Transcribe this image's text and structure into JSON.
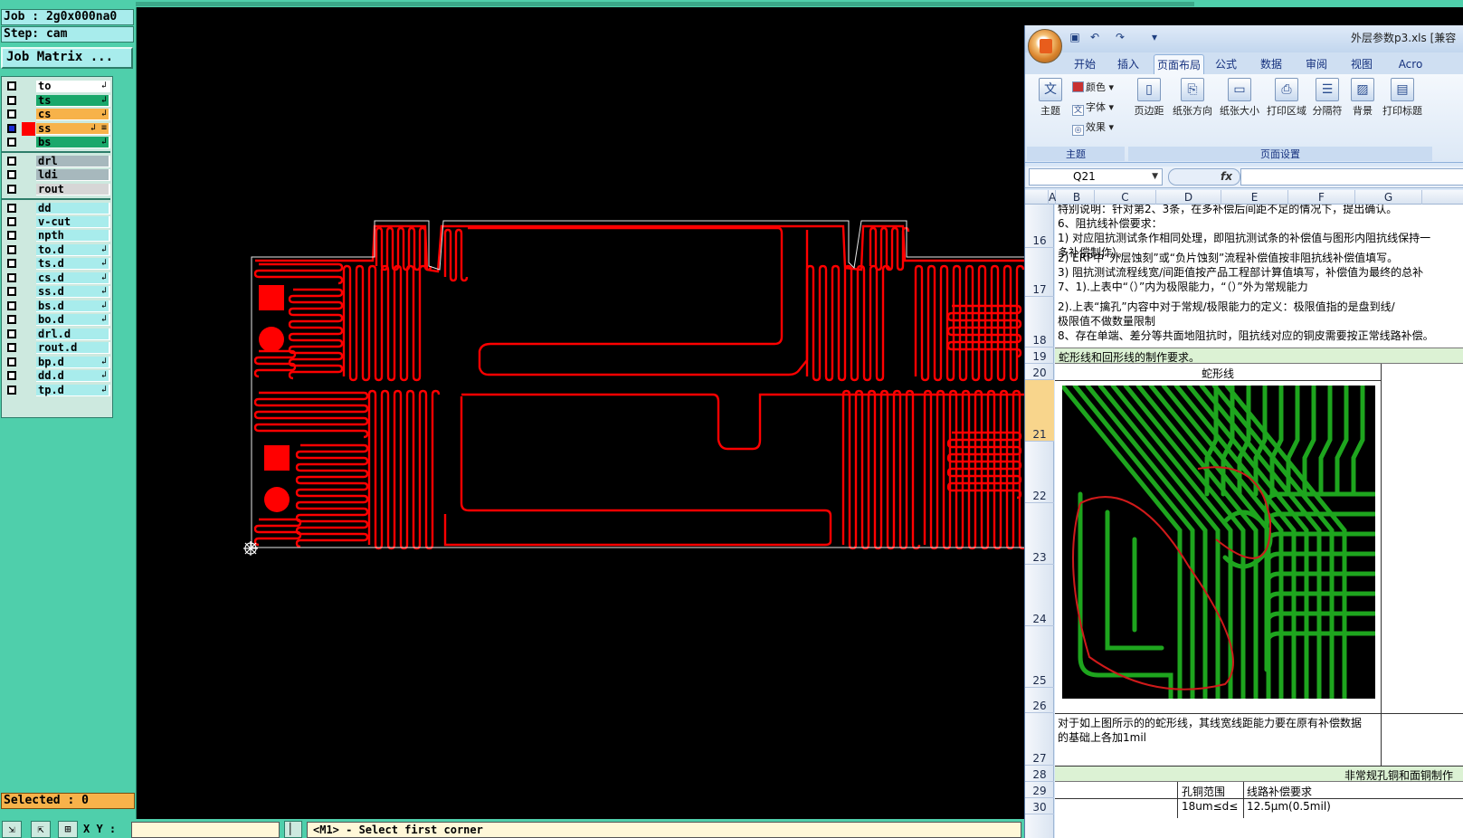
{
  "cam": {
    "job": "Job : 2g0x000na0",
    "step": "Step: cam",
    "job_matrix": "Job Matrix ...",
    "selected": "Selected : 0",
    "xy_label": "X Y :",
    "status": "<M1> - Select first corner",
    "layers": [
      {
        "name": "to",
        "color": "#ffffff",
        "checked": false,
        "flag": "↲"
      },
      {
        "name": "ts",
        "color": "#1aa86b",
        "checked": false,
        "flag": "↲"
      },
      {
        "name": "cs",
        "color": "#f7b24a",
        "checked": false,
        "flag": "↲"
      },
      {
        "name": "ss",
        "color": "#f7b24a",
        "checked": true,
        "flag": "↲ ≡"
      },
      {
        "name": "bs",
        "color": "#1aa86b",
        "checked": false,
        "flag": "↲"
      },
      {
        "name": "drl",
        "color": "#a7b8bd",
        "checked": false,
        "flag": ""
      },
      {
        "name": "ldi",
        "color": "#a7b8bd",
        "checked": false,
        "flag": ""
      },
      {
        "name": "rout",
        "color": "#d6d6d6",
        "checked": false,
        "flag": ""
      },
      {
        "name": "dd",
        "color": "#a8ecec",
        "checked": false,
        "flag": ""
      },
      {
        "name": "v-cut",
        "color": "#a8ecec",
        "checked": false,
        "flag": ""
      },
      {
        "name": "npth",
        "color": "#a8ecec",
        "checked": false,
        "flag": ""
      },
      {
        "name": "to.d",
        "color": "#a8ecec",
        "checked": false,
        "flag": "↲"
      },
      {
        "name": "ts.d",
        "color": "#a8ecec",
        "checked": false,
        "flag": "↲"
      },
      {
        "name": "cs.d",
        "color": "#a8ecec",
        "checked": false,
        "flag": "↲"
      },
      {
        "name": "ss.d",
        "color": "#a8ecec",
        "checked": false,
        "flag": "↲"
      },
      {
        "name": "bs.d",
        "color": "#a8ecec",
        "checked": false,
        "flag": "↲"
      },
      {
        "name": "bo.d",
        "color": "#a8ecec",
        "checked": false,
        "flag": "↲"
      },
      {
        "name": "drl.d",
        "color": "#a8ecec",
        "checked": false,
        "flag": ""
      },
      {
        "name": "rout.d",
        "color": "#a8ecec",
        "checked": false,
        "flag": ""
      },
      {
        "name": "bp.d",
        "color": "#a8ecec",
        "checked": false,
        "flag": "↲"
      },
      {
        "name": "dd.d",
        "color": "#a8ecec",
        "checked": false,
        "flag": "↲"
      },
      {
        "name": "tp.d",
        "color": "#a8ecec",
        "checked": false,
        "flag": "↲"
      }
    ],
    "trace_color": "#ff0000"
  },
  "excel": {
    "filename": "外层参数p3.xls  [兼容",
    "tabs": [
      "开始",
      "插入",
      "页面布局",
      "公式",
      "数据",
      "审阅",
      "视图",
      "Acro"
    ],
    "active_tab": "页面布局",
    "ribbon": {
      "theme_label": "主题",
      "colors_label": "颜色",
      "fonts_label": "字体",
      "effects_label": "效果",
      "margins_label": "页边距",
      "orientation_label": "纸张方向",
      "size_label": "纸张大小",
      "print_area_label": "打印区域",
      "breaks_label": "分隔符",
      "background_label": "背景",
      "print_titles_label": "打印标题",
      "group_theme": "主题",
      "group_page_setup": "页面设置"
    },
    "name_box": "Q21",
    "fx": "fx",
    "columns": [
      "A",
      "B",
      "C",
      "D",
      "E",
      "F",
      "G"
    ],
    "rows": [
      {
        "num": "16",
        "lines": [
          "特别说明：针对第2、3条，在多补偿后间距不足的情况下，提出确认。",
          "6、阻抗线补偿要求：",
          "1) 对应阻抗测试条作相同处理，即阻抗测试条的补偿值与图形内阻抗线保持一",
          "多补偿制作）。"
        ]
      },
      {
        "num": "17",
        "lines": [
          "2) ERP中“外层蚀刻”或“负片蚀刻”流程补偿值按非阻抗线补偿值填写。",
          "3) 阻抗测试流程线宽/间距值按产品工程部计算值填写，补偿值为最终的总补",
          "7、1).上表中“（）”内为极限能力，“（）”外为常规能力"
        ]
      },
      {
        "num": "18",
        "lines": [
          "    2).上表“擒孔”内容中对于常规/极限能力的定义：极限值指的是盘到线/",
          "极限值不做数量限制",
          "8、存在单端、差分等共面地阻抗时，阻抗线对应的铜皮需要按正常线路补偿。"
        ]
      },
      {
        "num": "19",
        "text": "蛇形线和回形线的制作要求。"
      },
      {
        "num": "20",
        "text": "蛇形线"
      },
      {
        "num": "21",
        "text": ""
      },
      {
        "num": "22",
        "text": ""
      },
      {
        "num": "23",
        "text": ""
      },
      {
        "num": "24",
        "text": ""
      },
      {
        "num": "25",
        "text": ""
      },
      {
        "num": "26",
        "text": ""
      },
      {
        "num": "27",
        "lines": [
          "对于如上图所示的的蛇形线，其线宽线距能力要在原有补偿数据",
          "的基础上各加1mil"
        ]
      },
      {
        "num": "28",
        "text": "非常规孔铜和面铜制作"
      },
      {
        "num": "29",
        "cells": [
          "孔铜范围",
          "线路补偿要求"
        ]
      },
      {
        "num": "30",
        "cells": [
          "18um≤d≤",
          "12.5μm(0.5mil)"
        ]
      }
    ],
    "image_trace_color": "#1ea51e"
  }
}
